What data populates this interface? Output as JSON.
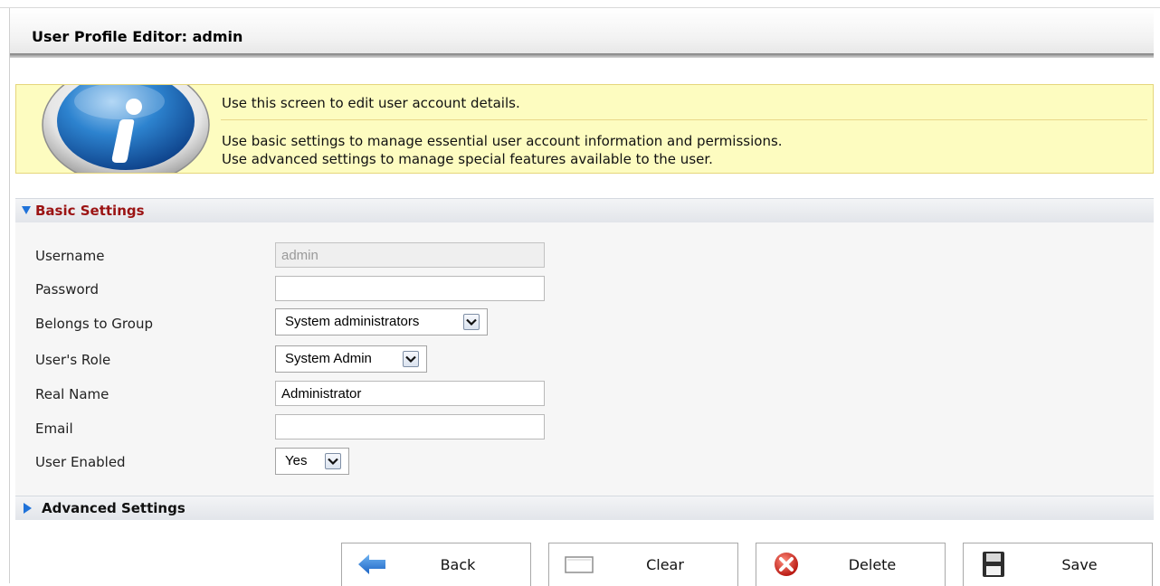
{
  "header": {
    "title": "User Profile Editor: admin"
  },
  "info": {
    "icon": "info-icon",
    "line1": "Use this screen to edit user account details.",
    "line2": "Use basic settings to manage essential user account information and permissions.",
    "line3": "Use advanced settings to manage special features available to the user."
  },
  "basic_settings": {
    "title": "Basic Settings",
    "expanded": true,
    "fields": {
      "username": {
        "label": "Username",
        "value": "admin",
        "disabled": true
      },
      "password": {
        "label": "Password",
        "value": ""
      },
      "group": {
        "label": "Belongs to Group",
        "selected": "System administrators"
      },
      "role": {
        "label": "User's Role",
        "selected": "System Admin"
      },
      "real_name": {
        "label": "Real Name",
        "value": "Administrator"
      },
      "email": {
        "label": "Email",
        "value": ""
      },
      "enabled": {
        "label": "User Enabled",
        "selected": "Yes"
      }
    }
  },
  "advanced_settings": {
    "title": "Advanced Settings",
    "expanded": false
  },
  "buttons": {
    "back": {
      "label": "Back",
      "icon": "back-arrow-icon"
    },
    "clear": {
      "label": "Clear",
      "icon": "clear-icon"
    },
    "delete": {
      "label": "Delete",
      "icon": "delete-icon"
    },
    "save": {
      "label": "Save",
      "icon": "save-disk-icon"
    }
  },
  "colors": {
    "info_background": "#fdfcc0",
    "section_title_basic": "#9b1313",
    "arrow_blue": "#1f72d9"
  }
}
